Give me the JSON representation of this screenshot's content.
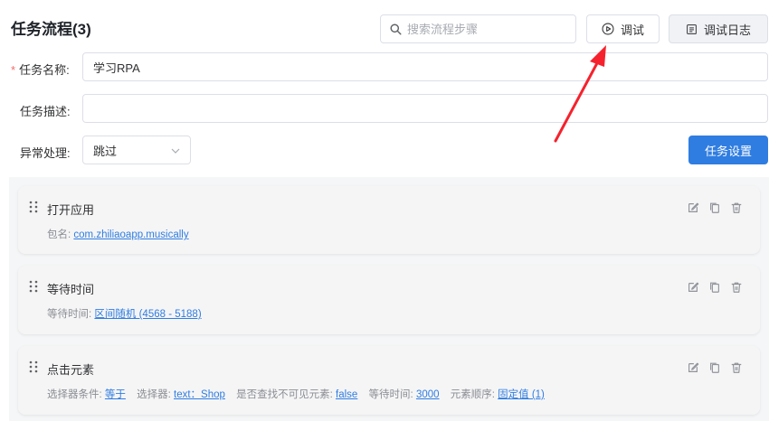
{
  "header": {
    "title": "任务流程",
    "count": "(3)",
    "search_placeholder": "搜索流程步骤",
    "debug_label": "调试",
    "debug_log_label": "调试日志"
  },
  "form": {
    "name_required_mark": "*",
    "name_label": "任务名称:",
    "name_value": "学习RPA",
    "desc_label": "任务描述:",
    "desc_value": "",
    "error_label": "异常处理:",
    "error_value": "跳过",
    "settings_label": "任务设置"
  },
  "steps": [
    {
      "title": "打开应用",
      "meta": [
        {
          "label": "包名:",
          "value": "com.zhiliaoapp.musically"
        }
      ]
    },
    {
      "title": "等待时间",
      "meta": [
        {
          "label": "等待时间:",
          "value": "区间随机 (4568 - 5188)"
        }
      ]
    },
    {
      "title": "点击元素",
      "meta": [
        {
          "label": "选择器条件:",
          "value": "等于"
        },
        {
          "label": "选择器:",
          "value": "text：Shop"
        },
        {
          "label": "是否查找不可见元素:",
          "value": "false"
        },
        {
          "label": "等待时间:",
          "value": "3000"
        },
        {
          "label": "元素顺序:",
          "value": "固定值 (1)"
        }
      ]
    }
  ],
  "colors": {
    "primary": "#2f7de1",
    "annotation_arrow": "#f5222d",
    "required": "#f56c6c"
  }
}
